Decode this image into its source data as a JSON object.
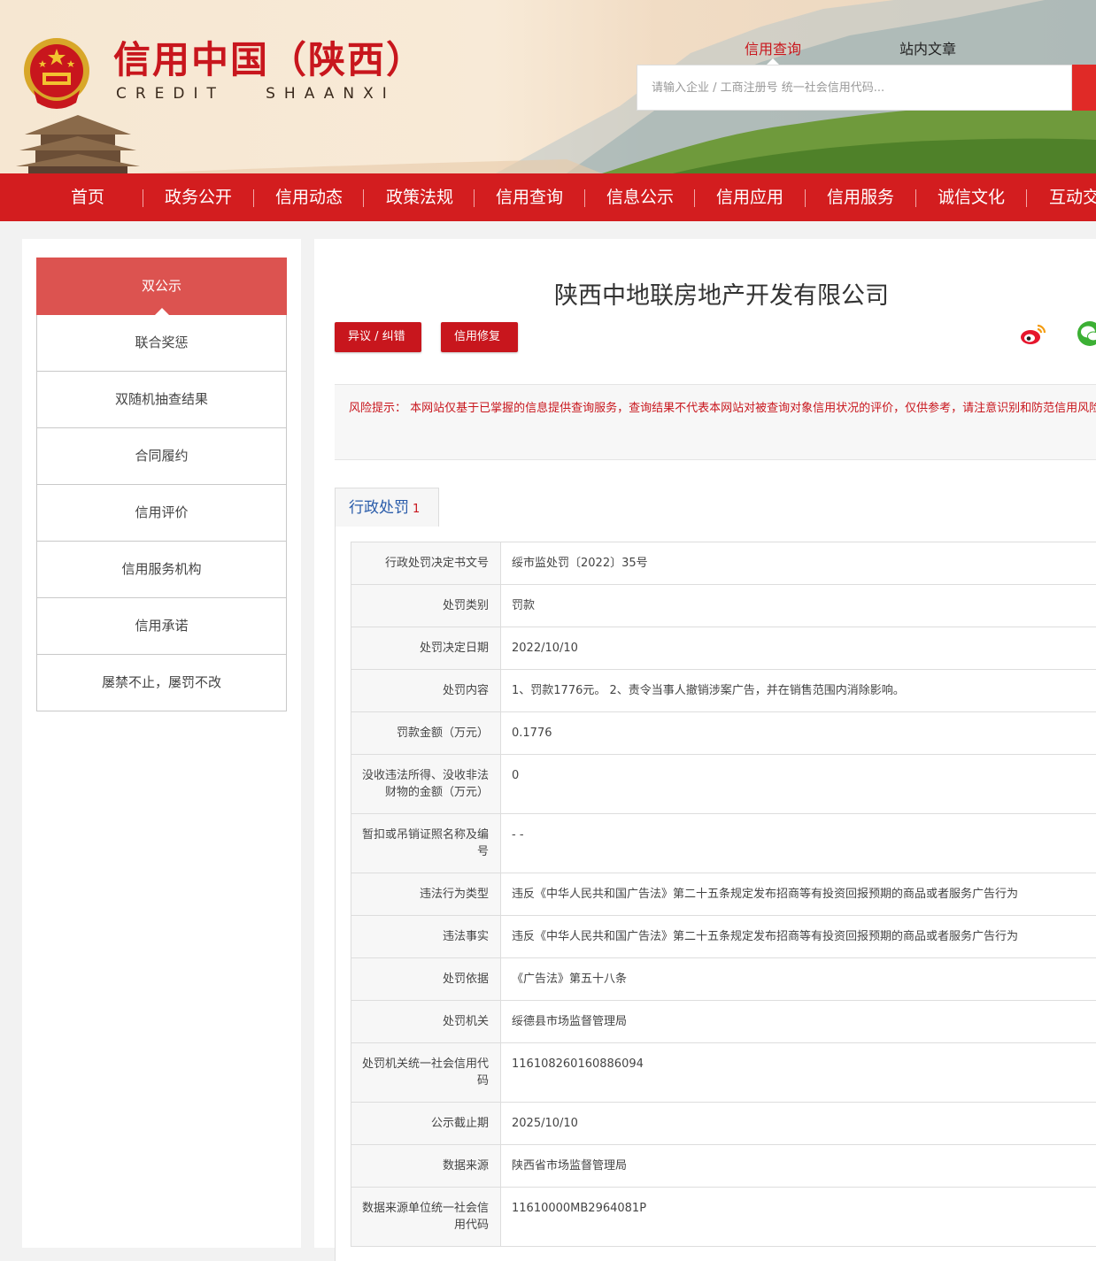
{
  "header": {
    "logo_cn": "信用中国（陕西）",
    "logo_en": "CREDIT   SHAANXI",
    "search_tabs": [
      "信用查询",
      "站内文章"
    ],
    "search_placeholder": "请输入企业 / 工商注册号 统一社会信用代码..."
  },
  "nav": {
    "items": [
      "首页",
      "政务公开",
      "信用动态",
      "政策法规",
      "信用查询",
      "信息公示",
      "信用应用",
      "信用服务",
      "诚信文化",
      "互动交"
    ]
  },
  "sidebar": {
    "items": [
      "双公示",
      "联合奖惩",
      "双随机抽查结果",
      "合同履约",
      "信用评价",
      "信用服务机构",
      "信用承诺",
      "屡禁不止，屡罚不改"
    ],
    "active_index": 0
  },
  "main": {
    "company_name": "陕西中地联房地产开发有限公司",
    "buttons": {
      "objection": "异议 / 纠错",
      "repair": "信用修复"
    },
    "risk_notice": "风险提示： 本网站仅基于已掌握的信息提供查询服务，查询结果不代表本网站对被查询对象信用状况的评价，仅供参考，请注意识别和防范信用风险。",
    "tab": {
      "label": "行政处罚",
      "count": "1"
    },
    "rows": [
      {
        "label": "行政处罚决定书文号",
        "value": "绥市监处罚〔2022〕35号"
      },
      {
        "label": "处罚类别",
        "value": "罚款"
      },
      {
        "label": "处罚决定日期",
        "value": "2022/10/10"
      },
      {
        "label": "处罚内容",
        "value": "1、罚款1776元。 2、责令当事人撤销涉案广告，并在销售范围内消除影响。"
      },
      {
        "label": "罚款金额（万元）",
        "value": "0.1776"
      },
      {
        "label": "没收违法所得、没收非法财物的金额（万元）",
        "value": "0"
      },
      {
        "label": "暂扣或吊销证照名称及编号",
        "value": "- -"
      },
      {
        "label": "违法行为类型",
        "value": "违反《中华人民共和国广告法》第二十五条规定发布招商等有投资回报预期的商品或者服务广告行为"
      },
      {
        "label": "违法事实",
        "value": "违反《中华人民共和国广告法》第二十五条规定发布招商等有投资回报预期的商品或者服务广告行为"
      },
      {
        "label": "处罚依据",
        "value": "《广告法》第五十八条"
      },
      {
        "label": "处罚机关",
        "value": "绥德县市场监督管理局"
      },
      {
        "label": "处罚机关统一社会信用代码",
        "value": "116108260160886094"
      },
      {
        "label": "公示截止期",
        "value": "2025/10/10"
      },
      {
        "label": "数据来源",
        "value": "陕西省市场监督管理局"
      },
      {
        "label": "数据来源单位统一社会信用代码",
        "value": "11610000MB2964081P"
      }
    ]
  },
  "colors": {
    "brand_red": "#d31d1f",
    "notice_red": "#c8161d",
    "tab_blue": "#2a5caa"
  }
}
